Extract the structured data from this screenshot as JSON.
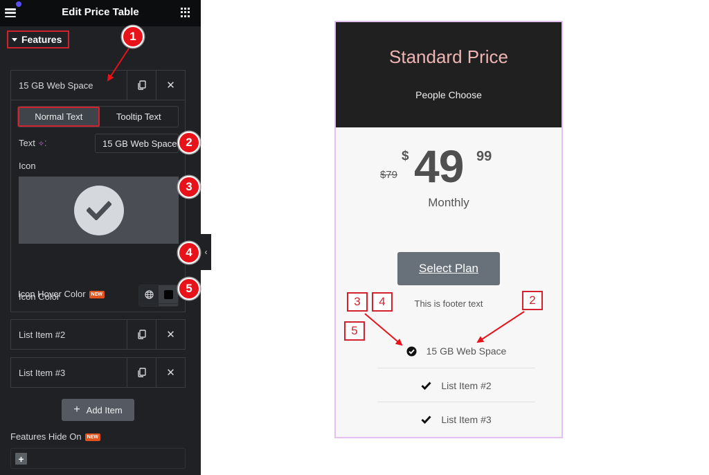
{
  "panel": {
    "title": "Edit Price Table",
    "section_title": "Features",
    "items": [
      {
        "label": "15 GB Web Space"
      },
      {
        "label": "List Item #2"
      },
      {
        "label": "List Item #3"
      }
    ],
    "tabs": [
      {
        "label": "Normal Text",
        "active": true
      },
      {
        "label": "Tooltip Text",
        "active": false
      }
    ],
    "text_label": "Text",
    "text_value": "15 GB Web Space",
    "icon_label": "Icon",
    "icon_color_label": "Icon Color",
    "icon_color": "#2a0808",
    "icon_hover_color_label": "Icon Hover Color",
    "icon_hover_color": "#050505",
    "new_badge": "NEW",
    "add_item_label": "Add Item",
    "hide_on_label": "Features Hide On"
  },
  "card": {
    "title": "Standard Price",
    "subtitle": "People Choose",
    "old_price": "$79",
    "currency": "$",
    "price": "49",
    "cents": "99",
    "period": "Monthly",
    "button_label": "Select Plan",
    "footer_text": "This is footer text",
    "features": [
      "15 GB Web Space",
      "List Item #2",
      "List Item #3"
    ]
  },
  "annotations": {
    "circle_markers": [
      "1",
      "2",
      "3",
      "4",
      "5"
    ],
    "square_markers": [
      "3",
      "4",
      "2",
      "5"
    ]
  },
  "colors": {
    "accent_red": "#d1222d",
    "card_title": "#efb4b4",
    "card_border": "#e4bff2"
  }
}
